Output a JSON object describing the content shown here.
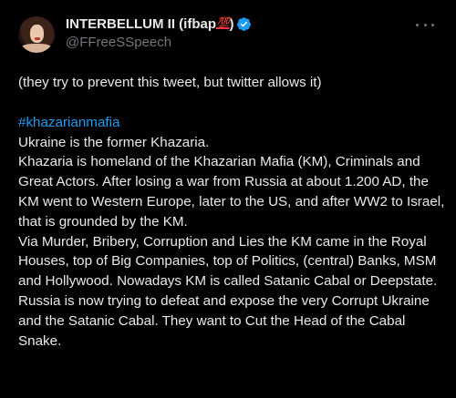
{
  "author": {
    "display_name": "INTERBELLUM II (ifbap",
    "emoji_100": "💯",
    "name_close": ")",
    "handle": "@FFreeSSpeech",
    "verified": true,
    "verified_color": "#1d9bf0"
  },
  "icons": {
    "avatar": "profile-photo",
    "verified": "verified-badge-icon",
    "more": "more-horizontal-icon"
  },
  "tweet": {
    "intro": "(they try to prevent this tweet, but twitter allows it)",
    "hashtag": "#khazarianmafia",
    "lines": [
      "Ukraine is the former Khazaria.",
      "Khazaria is homeland of the Khazarian Mafia (KM), Criminals and Great Actors. After losing a war from Russia at about 1.200 AD, the KM went to Western Europe, later to the US, and after WW2 to Israel, that is grounded by the KM.",
      "Via Murder, Bribery, Corruption and Lies the KM came in the Royal Houses, top of Big Companies, top of Politics, (central) Banks, MSM and Hollywood. Nowadays KM is called Satanic Cabal or Deepstate.",
      "Russia is now trying to defeat and expose the very Corrupt Ukraine and the Satanic Cabal. They want to Cut the Head of the Cabal Snake."
    ]
  },
  "colors": {
    "background": "#000000",
    "text": "#e7e9ea",
    "secondary": "#71767b",
    "link": "#1d9bf0"
  }
}
